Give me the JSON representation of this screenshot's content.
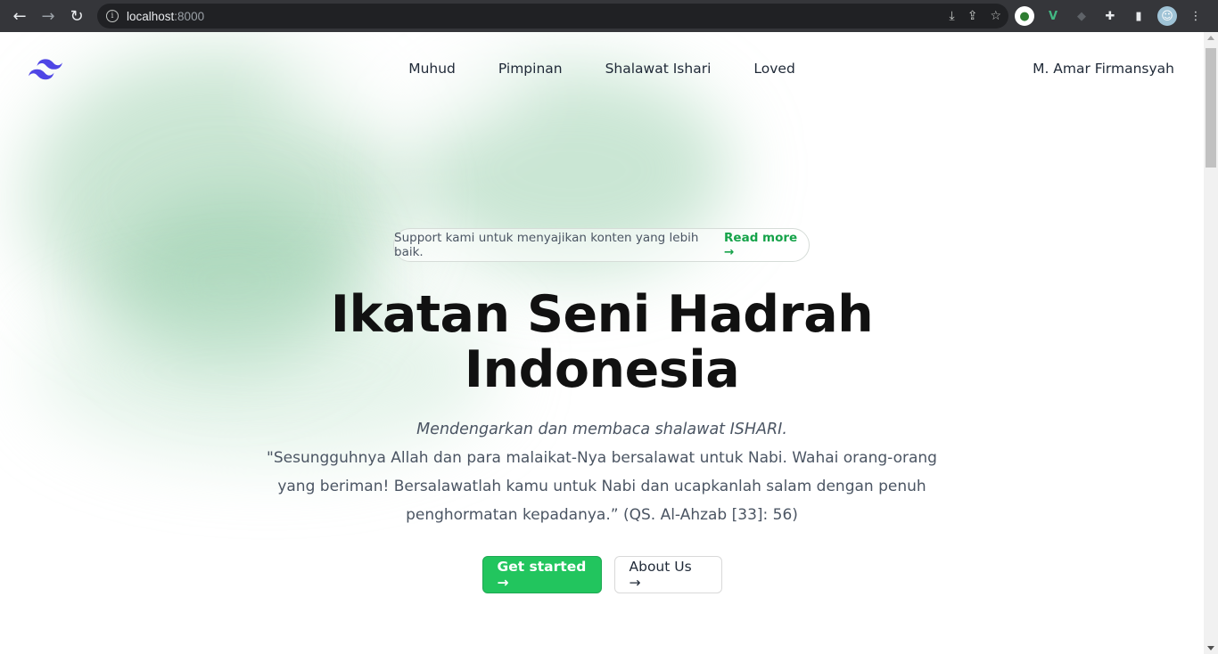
{
  "browser": {
    "url_host": "localhost",
    "url_port": ":8000"
  },
  "site": {
    "nav": [
      "Muhud",
      "Pimpinan",
      "Shalawat Ishari",
      "Loved"
    ],
    "user_name": "M. Amar Firmansyah"
  },
  "hero": {
    "announcement": "Support kami untuk menyajikan konten yang lebih baik.",
    "announcement_link": "Read more →",
    "title_line1": "Ikatan Seni Hadrah",
    "title_line2": "Indonesia",
    "subtitle": "Mendengarkan dan membaca shalawat ISHARI.",
    "quote": "\"Sesungguhnya Allah dan para malaikat-Nya bersalawat untuk Nabi. Wahai orang-orang yang beriman! Bersalawatlah kamu untuk Nabi dan ucapkanlah salam dengan penuh penghormatan kepadanya.” (QS. Al-Ahzab [33]: 56)",
    "primary_button": "Get started →",
    "secondary_button": "About Us →"
  },
  "colors": {
    "accent": "#22c55e",
    "link": "#16a34a",
    "logo": "#4f46e5"
  }
}
